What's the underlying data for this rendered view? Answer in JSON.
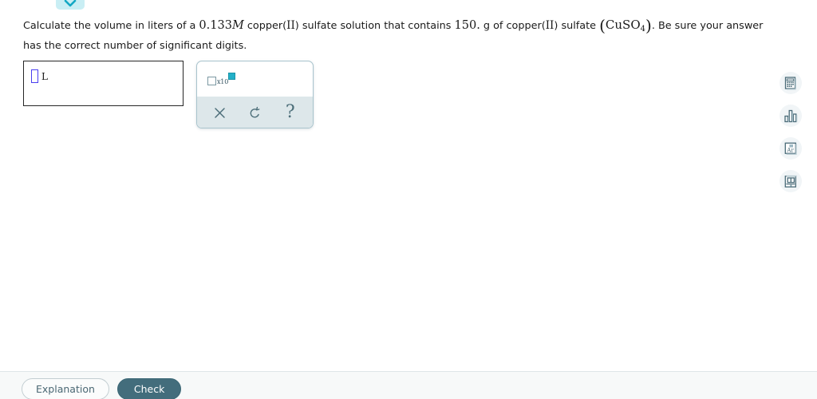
{
  "top_tab": {
    "icon": "chevron-down-icon",
    "background": "#c9eef4",
    "chevron_color": "#13a8c4"
  },
  "question": {
    "prefix": "Calculate the volume in liters of a ",
    "molarity_value": "0.133",
    "molarity_unit": "M",
    "middle": " copper(",
    "roman_two_a": "II",
    "middle2": ") sulfate solution that contains ",
    "mass_value": "150.",
    "middle3": " g of copper(",
    "roman_two_b": "II",
    "middle4": ") sulfate ",
    "formula_open": "(",
    "formula_main": "CuSO",
    "formula_sub": "4",
    "formula_close": ")",
    "suffix": ". Be sure your answer has the correct number of significant digits."
  },
  "answer_input": {
    "name": "answer-field",
    "value": "",
    "placeholder": "",
    "unit_label": "L",
    "cursor_color": "#4a3ef0"
  },
  "palette": {
    "sci_notation": {
      "label": "x10",
      "name": "scientific-notation-button",
      "exponent_color": "#23b0c8"
    },
    "actions": [
      {
        "name": "clear-button",
        "icon": "close-icon",
        "label": "×"
      },
      {
        "name": "undo-button",
        "icon": "undo-icon",
        "label": "↺"
      },
      {
        "name": "help-button",
        "icon": "question-mark-icon",
        "label": "?"
      }
    ]
  },
  "sidebar_tools": [
    {
      "name": "periodic-table-tool",
      "icon": "periodic-table-icon"
    },
    {
      "name": "chart-tool",
      "icon": "bar-chart-icon"
    },
    {
      "name": "text-format-tool",
      "icon": "aa-text-icon"
    },
    {
      "name": "reference-tool",
      "icon": "reference-document-icon"
    }
  ],
  "footer": {
    "explanation_label": "Explanation",
    "check_label": "Check",
    "check_color": "#436d7c"
  }
}
